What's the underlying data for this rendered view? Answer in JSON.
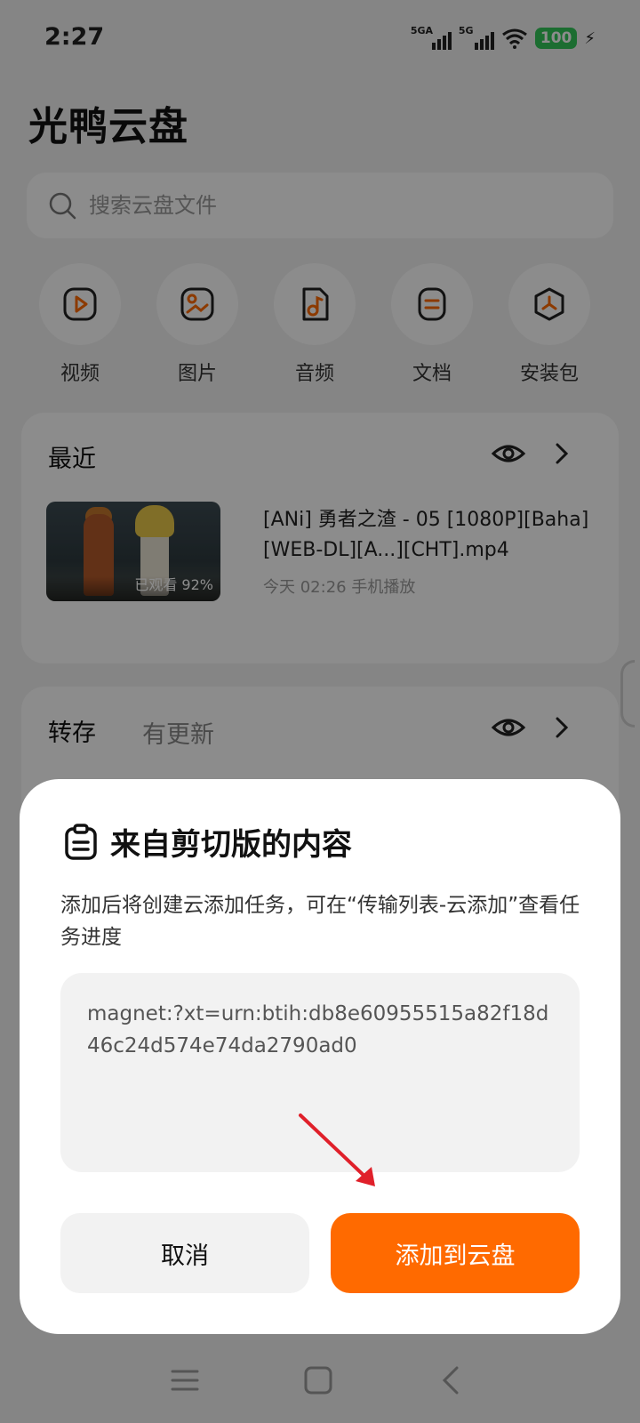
{
  "status_bar": {
    "time": "2:27",
    "signal_1": "5GA",
    "signal_2": "5G",
    "battery": "100",
    "icons": [
      "signal-icon",
      "wifi-icon",
      "battery-icon",
      "charging-icon"
    ]
  },
  "app": {
    "title": "光鸭云盘",
    "search_placeholder": "搜索云盘文件",
    "accent": "#ff6a00"
  },
  "categories": [
    {
      "label": "视频",
      "icon": "video-icon"
    },
    {
      "label": "图片",
      "icon": "image-icon"
    },
    {
      "label": "音频",
      "icon": "audio-icon"
    },
    {
      "label": "文档",
      "icon": "document-icon"
    },
    {
      "label": "安装包",
      "icon": "package-icon"
    }
  ],
  "recent": {
    "title": "最近",
    "file_name": "[ANi] 勇者之渣 - 05 [1080P][Baha][WEB-DL][A...][CHT].mp4",
    "watched": "已观看 92%",
    "meta": "今天 02:26 手机播放"
  },
  "transfer": {
    "title": "转存",
    "subtitle": "有更新"
  },
  "dialog": {
    "title": "来自剪切版的内容",
    "description": "添加后将创建云添加任务，可在“传输列表-云添加”查看任务进度",
    "magnet": "magnet:?xt=urn:btih:db8e60955515a82f18d46c24d574e74da2790ad0",
    "cancel_label": "取消",
    "add_label": "添加到云盘"
  },
  "nav": {
    "icons": [
      "menu-icon",
      "home-icon",
      "back-icon"
    ]
  }
}
